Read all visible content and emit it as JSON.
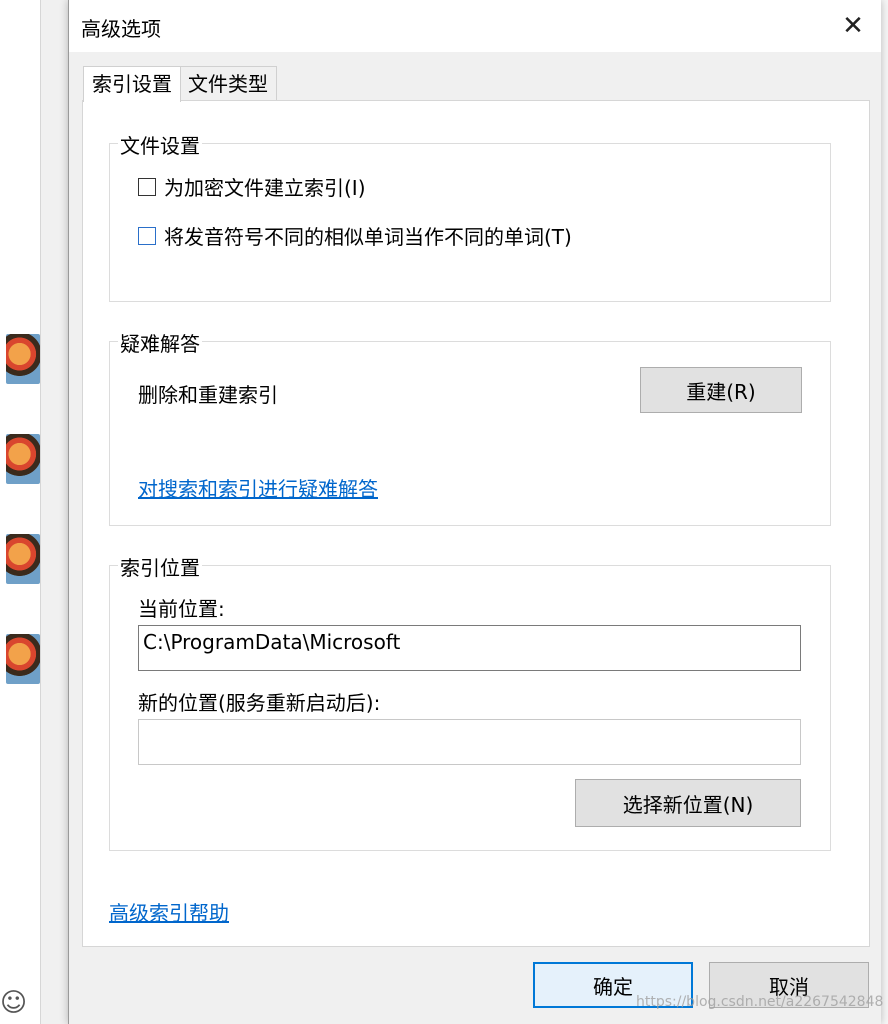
{
  "dialog": {
    "title": "高级选项",
    "close_glyph": "✕"
  },
  "tabs": [
    {
      "label": "索引设置",
      "active": true
    },
    {
      "label": "文件类型",
      "active": false
    }
  ],
  "file_settings": {
    "title": "文件设置",
    "options": [
      {
        "label": "为加密文件建立索引(I)",
        "checked": false
      },
      {
        "label": "将发音符号不同的相似单词当作不同的单词(T)",
        "checked": false
      }
    ]
  },
  "troubleshoot": {
    "title": "疑难解答",
    "rebuild_text": "删除和重建索引",
    "rebuild_button": "重建(R)",
    "help_link": "对搜索和索引进行疑难解答"
  },
  "index_location": {
    "title": "索引位置",
    "current_label": "当前位置:",
    "current_value": "C:\\ProgramData\\Microsoft",
    "new_label": "新的位置(服务重新启动后):",
    "new_value": "",
    "select_button": "选择新位置(N)"
  },
  "advanced_help_link": "高级索引帮助",
  "footer": {
    "ok": "确定",
    "cancel": "取消"
  },
  "watermark": "https://blog.csdn.net/a2267542848",
  "background": {
    "emoji_glyph": "☺"
  }
}
